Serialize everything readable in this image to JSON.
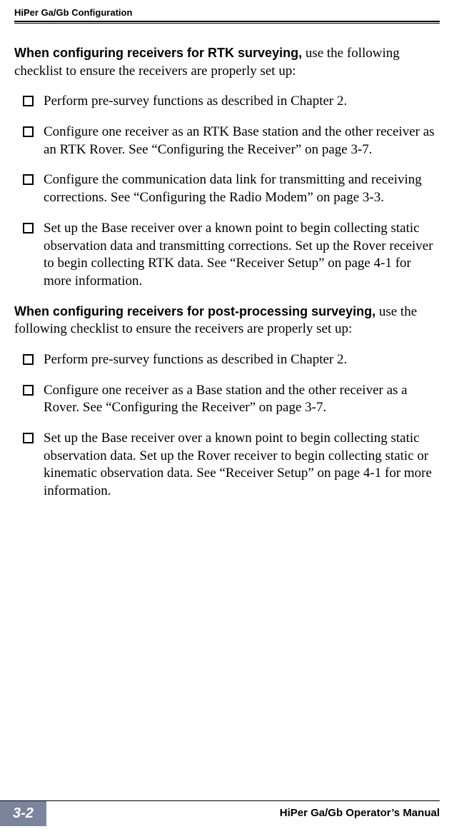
{
  "header": {
    "title": "HiPer Ga/Gb Configuration"
  },
  "sections": [
    {
      "lead": "When configuring receivers for RTK surveying,",
      "intro": " use the following checklist to ensure the receivers are properly set up:",
      "items": [
        "Perform pre-survey functions as described in Chapter 2.",
        "Configure one receiver as an RTK Base station and the other receiver as an RTK Rover. See “Configuring the Receiver” on page 3-7.",
        "Configure the communication data link for transmitting and receiving corrections. See “Configuring the Radio Modem” on page 3-3.",
        "Set up the Base receiver over a known point to begin collecting static observation data and transmitting corrections. Set up the Rover receiver to begin collecting RTK data. See “Receiver Setup” on page 4-1 for more information."
      ]
    },
    {
      "lead": "When configuring receivers for post-processing surveying,",
      "intro": " use the following checklist to ensure the receivers are properly set up:",
      "items": [
        "Perform pre-survey functions as described in Chapter 2.",
        "Configure one receiver as a Base station and the other receiver as a Rover. See “Configuring the Receiver” on page 3-7.",
        "Set up the Base receiver over a known point to begin collecting static observation data. Set up the Rover receiver to begin collecting static or kinematic observation data. See “Receiver Setup” on page 4-1 for more information."
      ]
    }
  ],
  "footer": {
    "page": "3-2",
    "manual": "HiPer Ga/Gb Operator’s Manual"
  }
}
